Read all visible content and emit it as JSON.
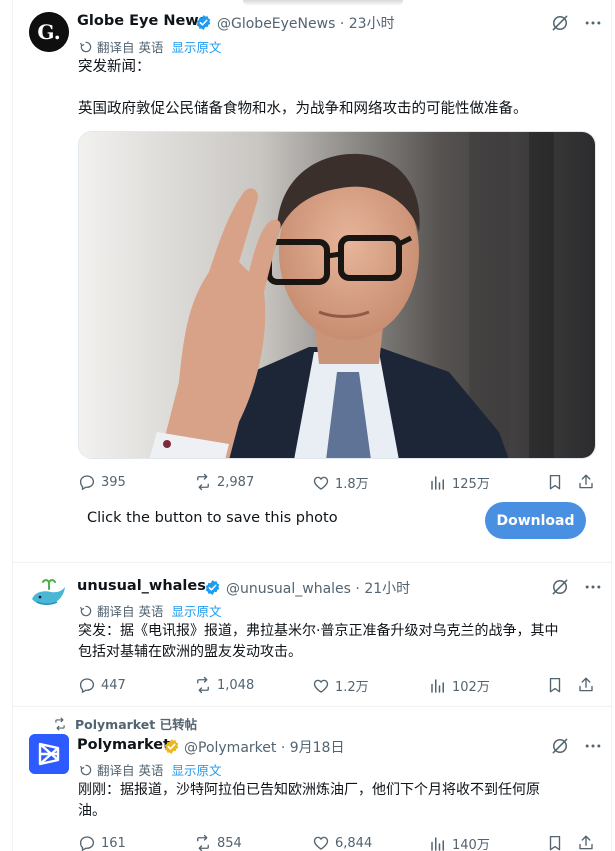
{
  "tweets": [
    {
      "name": "Globe Eye News",
      "handle": "@GlobeEyeNews",
      "sep": "·",
      "time": "23小时",
      "translate_label": "翻译自 英语",
      "show_original": "显示原文",
      "text_line1": "突发新闻：",
      "text_line2": "英国政府敦促公民储备食物和水，为战争和网络攻击的可能性做准备。",
      "replies": "395",
      "reposts": "2,987",
      "likes": "1.8万",
      "views": "125万",
      "avatar_letter": "G."
    },
    {
      "name": "unusual_whales",
      "handle": "@unusual_whales",
      "sep": "·",
      "time": "21小时",
      "translate_label": "翻译自 英语",
      "show_original": "显示原文",
      "text_line1": "突发：据《电讯报》报道，弗拉基米尔·普京正准备升级对乌克兰的战争，其中",
      "text_line2": "包括对基辅在欧洲的盟友发动攻击。",
      "replies": "447",
      "reposts": "1,048",
      "likes": "1.2万",
      "views": "102万"
    },
    {
      "name": "Polymarket",
      "handle": "@Polymarket",
      "sep": "·",
      "time": "9月18日",
      "translate_label": "翻译自 英语",
      "show_original": "显示原文",
      "text_line1": "刚刚：据报道，沙特阿拉伯已告知欧洲炼油厂，他们下个月将收不到任何原",
      "text_line2": "油。",
      "replies": "161",
      "reposts": "854",
      "likes": "6,844",
      "views": "140万"
    }
  ],
  "save_prompt": {
    "text": "Click the button to save this photo",
    "button_label": "Download"
  },
  "repost_label": "Polymarket 已转帖",
  "colors": {
    "verified_blue": "#1d9bf0",
    "verified_gold": "#e8b923",
    "download_button": "#4a90e2",
    "link": "#1d9bf0",
    "muted": "#536471"
  },
  "icons": [
    "grok-icon",
    "translate-icon",
    "reply-icon",
    "repost-icon",
    "like-icon",
    "views-icon",
    "bookmark-icon",
    "share-icon",
    "verified-badge-icon"
  ]
}
